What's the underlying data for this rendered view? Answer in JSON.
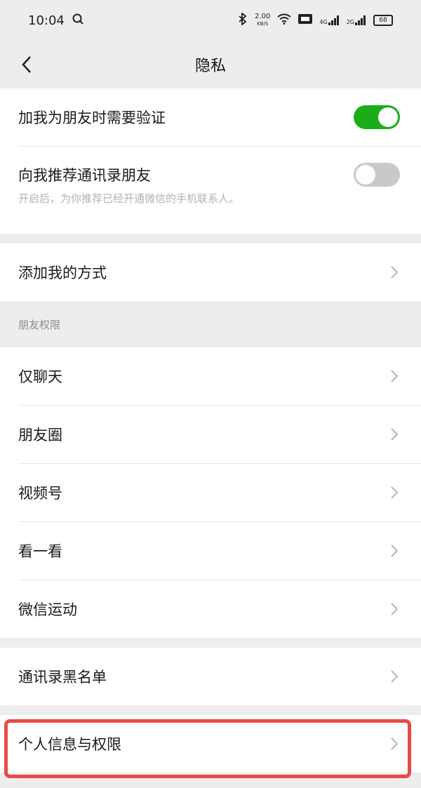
{
  "status_bar": {
    "time": "10:04",
    "speed": "2.00",
    "speed_unit": "KB/S",
    "signal1_label": "4G",
    "signal2_label": "2G",
    "battery": "68"
  },
  "nav": {
    "title": "隐私"
  },
  "verify_section": {
    "require_verification": {
      "label": "加我为朋友时需要验证",
      "enabled": true
    },
    "recommend_contacts": {
      "label": "向我推荐通讯录朋友",
      "enabled": false
    },
    "hint": "开启后，为你推荐已经开通微信的手机联系人。"
  },
  "add_methods": {
    "label": "添加我的方式"
  },
  "friend_permissions": {
    "section_label": "朋友权限",
    "items": [
      {
        "label": "仅聊天"
      },
      {
        "label": "朋友圈"
      },
      {
        "label": "视频号"
      },
      {
        "label": "看一看"
      },
      {
        "label": "微信运动"
      }
    ]
  },
  "blacklist": {
    "label": "通讯录黑名单"
  },
  "personal_info": {
    "label": "个人信息与权限"
  },
  "colors": {
    "toggle_on": "#1aad19",
    "toggle_off": "#c9c9c9",
    "highlight": "#e84a4a",
    "background": "#ededed"
  }
}
